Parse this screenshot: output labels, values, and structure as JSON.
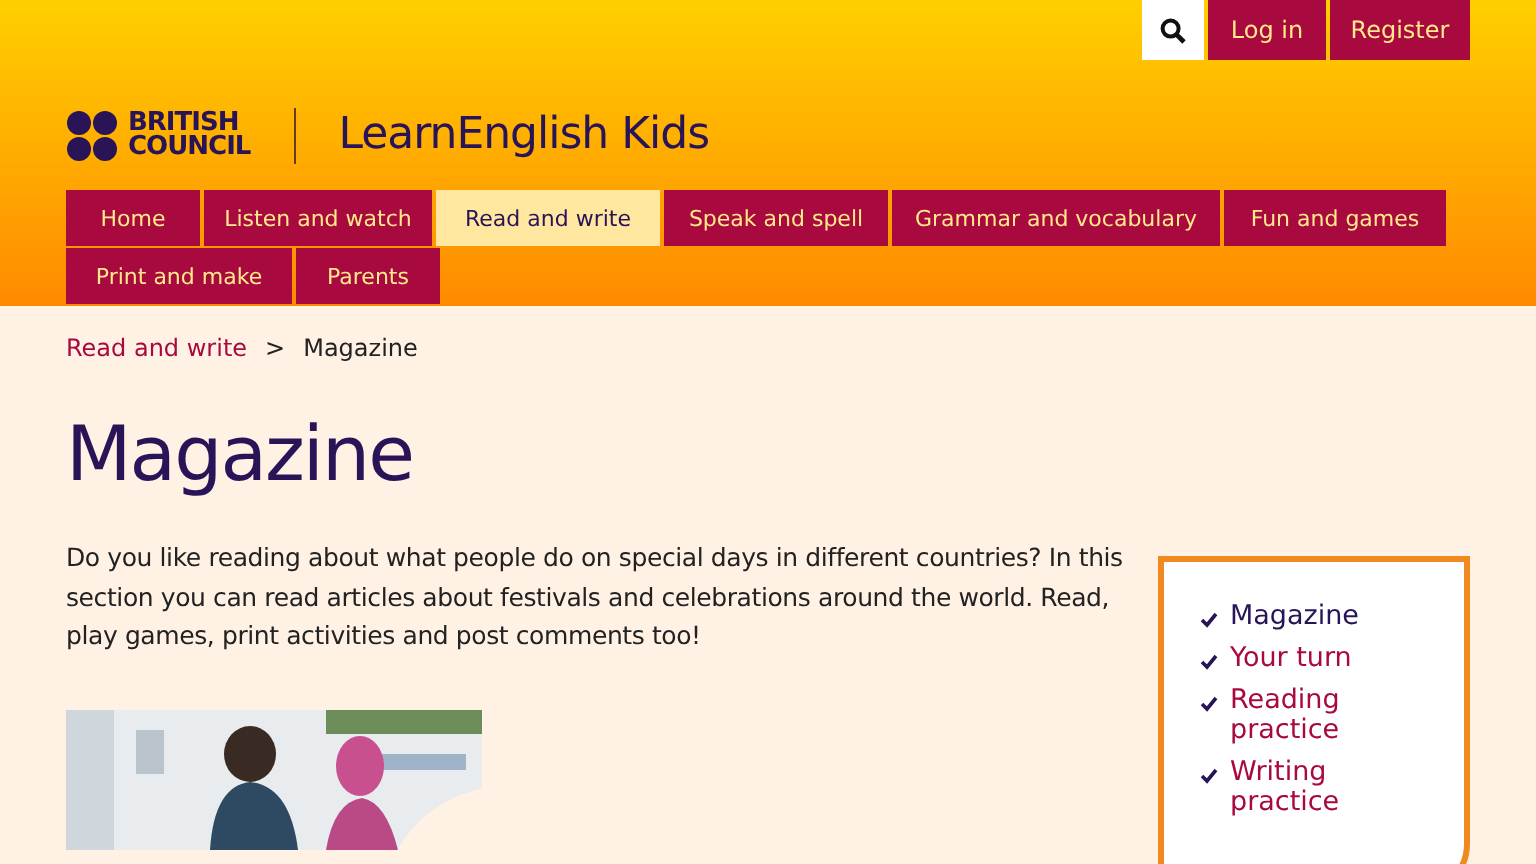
{
  "top_bar": {
    "buttons": [
      {
        "kind": "search"
      },
      {
        "kind": "text",
        "label": "Log in"
      },
      {
        "kind": "text",
        "label": "Register"
      }
    ]
  },
  "logo": {
    "lines": [
      "BRITISH",
      "COUNCIL"
    ],
    "site_name": "LearnEnglish Kids"
  },
  "nav": {
    "rows": [
      [
        {
          "label": "Home",
          "selected": false
        },
        {
          "label": "Listen and watch",
          "selected": false
        },
        {
          "label": "Read and write",
          "selected": true
        },
        {
          "label": "Speak and spell",
          "selected": false
        },
        {
          "label": "Grammar and vocabulary",
          "selected": false
        },
        {
          "label": "Fun and games",
          "selected": false
        }
      ],
      [
        {
          "label": "Print and make",
          "selected": false
        },
        {
          "label": "Parents",
          "selected": false
        }
      ]
    ]
  },
  "breadcrumb": {
    "link": "Read and write",
    "separator": ">",
    "current": "Magazine"
  },
  "title": "Magazine",
  "intro": "Do you like reading about what people do on special days in different countries? In this section you can read articles about festivals and celebrations around the world. Read, play games, print activities and post comments too!",
  "sidebar": {
    "items": [
      {
        "label": "Magazine",
        "selected": true
      },
      {
        "label": "Your turn",
        "selected": false
      },
      {
        "label": "Reading practice",
        "selected": false
      },
      {
        "label": "Writing practice",
        "selected": false
      }
    ]
  }
}
